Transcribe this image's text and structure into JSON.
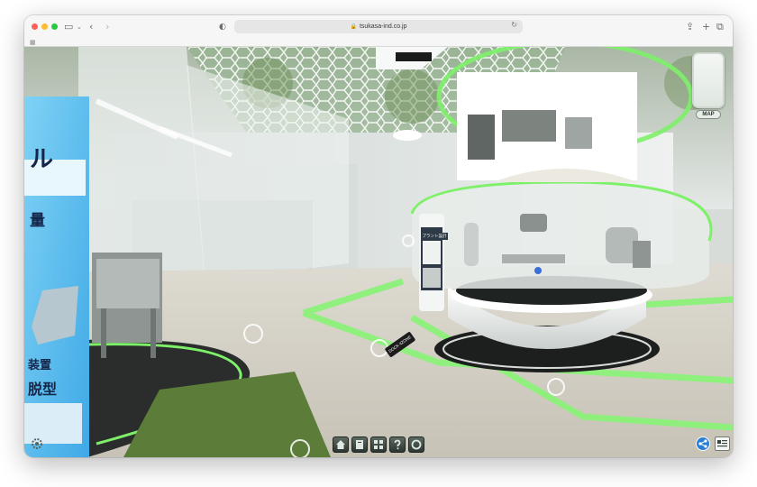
{
  "browser": {
    "url": "tsukasa-ind.co.jp",
    "traffic_colors": {
      "close": "#fe5f57",
      "minimize": "#febc2e",
      "maximize": "#28c840"
    }
  },
  "scene": {
    "map_label": "MAP",
    "left_panel_lines": [
      "ル",
      "量",
      "装置",
      "脱型"
    ],
    "floor_sign": "DOCK 4ZONE",
    "kiosk_title": "プラント設計",
    "accent_color": "#7ef06a",
    "nav_buttons": [
      {
        "name": "home-icon",
        "label": "home"
      },
      {
        "name": "book-icon",
        "label": "catalog"
      },
      {
        "name": "grid-icon",
        "label": "layout"
      },
      {
        "name": "help-icon",
        "label": "?"
      },
      {
        "name": "chat-icon",
        "label": "contact"
      }
    ]
  }
}
